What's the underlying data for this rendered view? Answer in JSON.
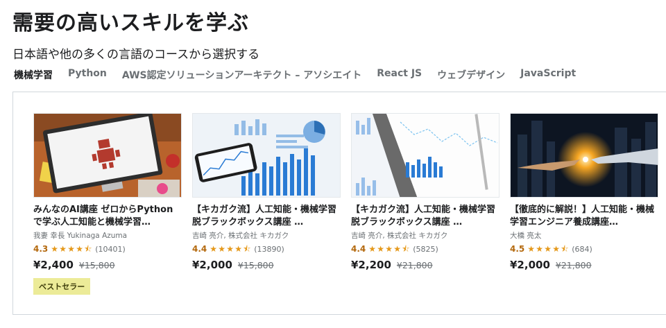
{
  "header": {
    "title": "需要の高いスキルを学ぶ",
    "subtitle": "日本語や他の多くの言語のコースから選択する"
  },
  "tabs": [
    {
      "label": "機械学習",
      "active": true
    },
    {
      "label": "Python",
      "active": false
    },
    {
      "label": "AWS認定ソリューションアーキテクト – アソシエイト",
      "active": false
    },
    {
      "label": "React JS",
      "active": false
    },
    {
      "label": "ウェブデザイン",
      "active": false
    },
    {
      "label": "JavaScript",
      "active": false
    }
  ],
  "courses": [
    {
      "title": "みんなのAI講座 ゼロからPythonで学ぶ人工知能と機械学習…",
      "author": "我妻 幸長 Yukinaga Azuma",
      "rating": "4.3",
      "stars": 4.3,
      "reviews": "(10401)",
      "price": "¥2,400",
      "original_price": "¥15,800",
      "badge": "ベストセラー",
      "thumbnail": "robot-on-monitor-image"
    },
    {
      "title": "【キカガク流】人工知能・機械学習 脱ブラックボックス講座 …",
      "author": "吉崎 亮介, 株式会社 キカガク",
      "rating": "4.4",
      "stars": 4.4,
      "reviews": "(13890)",
      "price": "¥2,000",
      "original_price": "¥15,800",
      "badge": "",
      "thumbnail": "charts-with-phone-image"
    },
    {
      "title": "【キカガク流】人工知能・機械学習 脱ブラックボックス講座 …",
      "author": "吉崎 亮介, 株式会社 キカガク",
      "rating": "4.4",
      "stars": 4.4,
      "reviews": "(5825)",
      "price": "¥2,200",
      "original_price": "¥21,800",
      "badge": "",
      "thumbnail": "charts-with-tablet-image"
    },
    {
      "title": "【徹底的に解説！】人工知能・機械学習エンジニア養成講座…",
      "author": "大橋 亮太",
      "rating": "4.5",
      "stars": 4.5,
      "reviews": "(684)",
      "price": "¥2,000",
      "original_price": "¥21,800",
      "badge": "",
      "thumbnail": "robot-hand-touch-image"
    }
  ],
  "colors": {
    "rating": "#b4690e",
    "star": "#e59819",
    "badge_bg": "#eceb98",
    "muted_text": "#6a6f73",
    "border": "#d1d7dc"
  }
}
